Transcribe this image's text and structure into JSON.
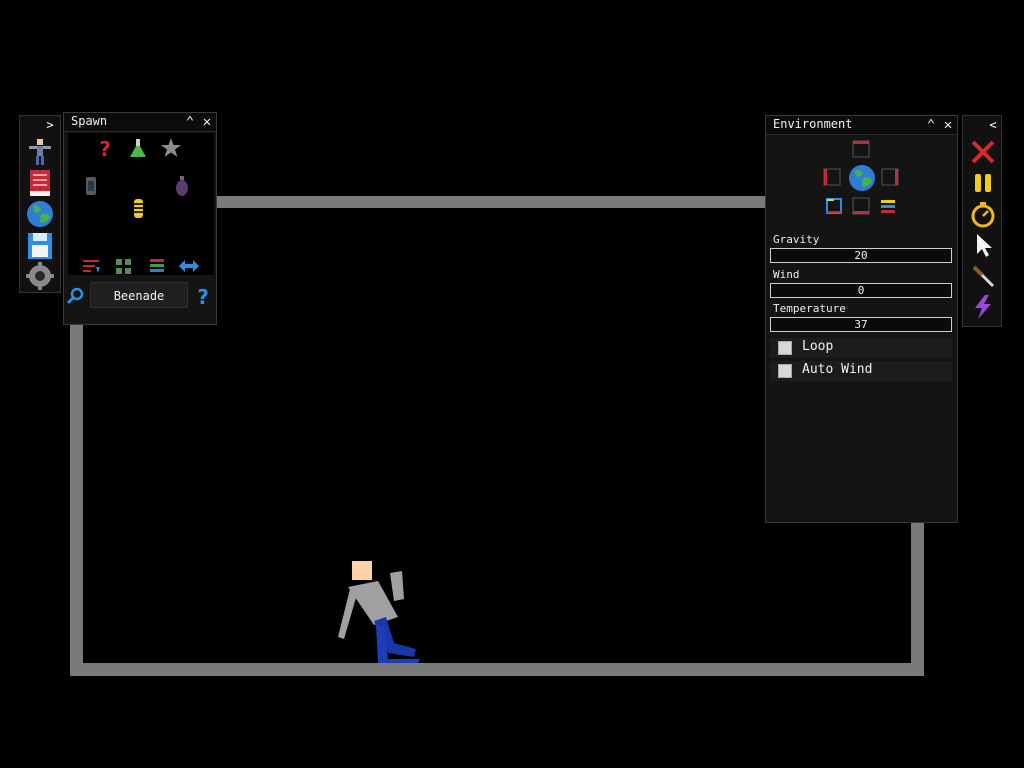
{
  "spawn_panel": {
    "title": "Spawn",
    "search_value": "Beenade",
    "items": [
      "question-icon",
      "flask-icon",
      "star-icon",
      "lantern-icon",
      "grenade-icon",
      "bee-grenade-icon"
    ],
    "bottom_tools": [
      "sort-icon",
      "grid-view-icon",
      "list-view-icon",
      "swap-arrows-icon"
    ]
  },
  "sidebar": {
    "items": [
      "ragdoll-icon",
      "book-icon",
      "globe-icon",
      "save-icon",
      "settings-gear-icon"
    ]
  },
  "environment_panel": {
    "title": "Environment",
    "preset_icons": [
      "top-wall-icon",
      "left-wall-icon",
      "globe-icon",
      "right-wall-icon",
      "color-box-icon",
      "bottom-wall-icon",
      "layers-icon"
    ],
    "gravity": {
      "label": "Gravity",
      "value": "20"
    },
    "wind": {
      "label": "Wind",
      "value": "0"
    },
    "temperature": {
      "label": "Temperature",
      "value": "37"
    },
    "loop": {
      "label": "Loop",
      "checked": false
    },
    "auto_wind": {
      "label": "Auto Wind",
      "checked": false
    }
  },
  "right_toolbar": {
    "items": [
      "clear-x-icon",
      "pause-icon",
      "stopwatch-icon",
      "pointer-icon",
      "knife-icon",
      "lightning-icon"
    ]
  },
  "colors": {
    "wall": "#7a7a7a",
    "panel_bg": "#141414",
    "ragdoll_skin": "#ffd3a8",
    "ragdoll_shirt": "#a0a0a0",
    "ragdoll_pants": "#1a37a8"
  }
}
